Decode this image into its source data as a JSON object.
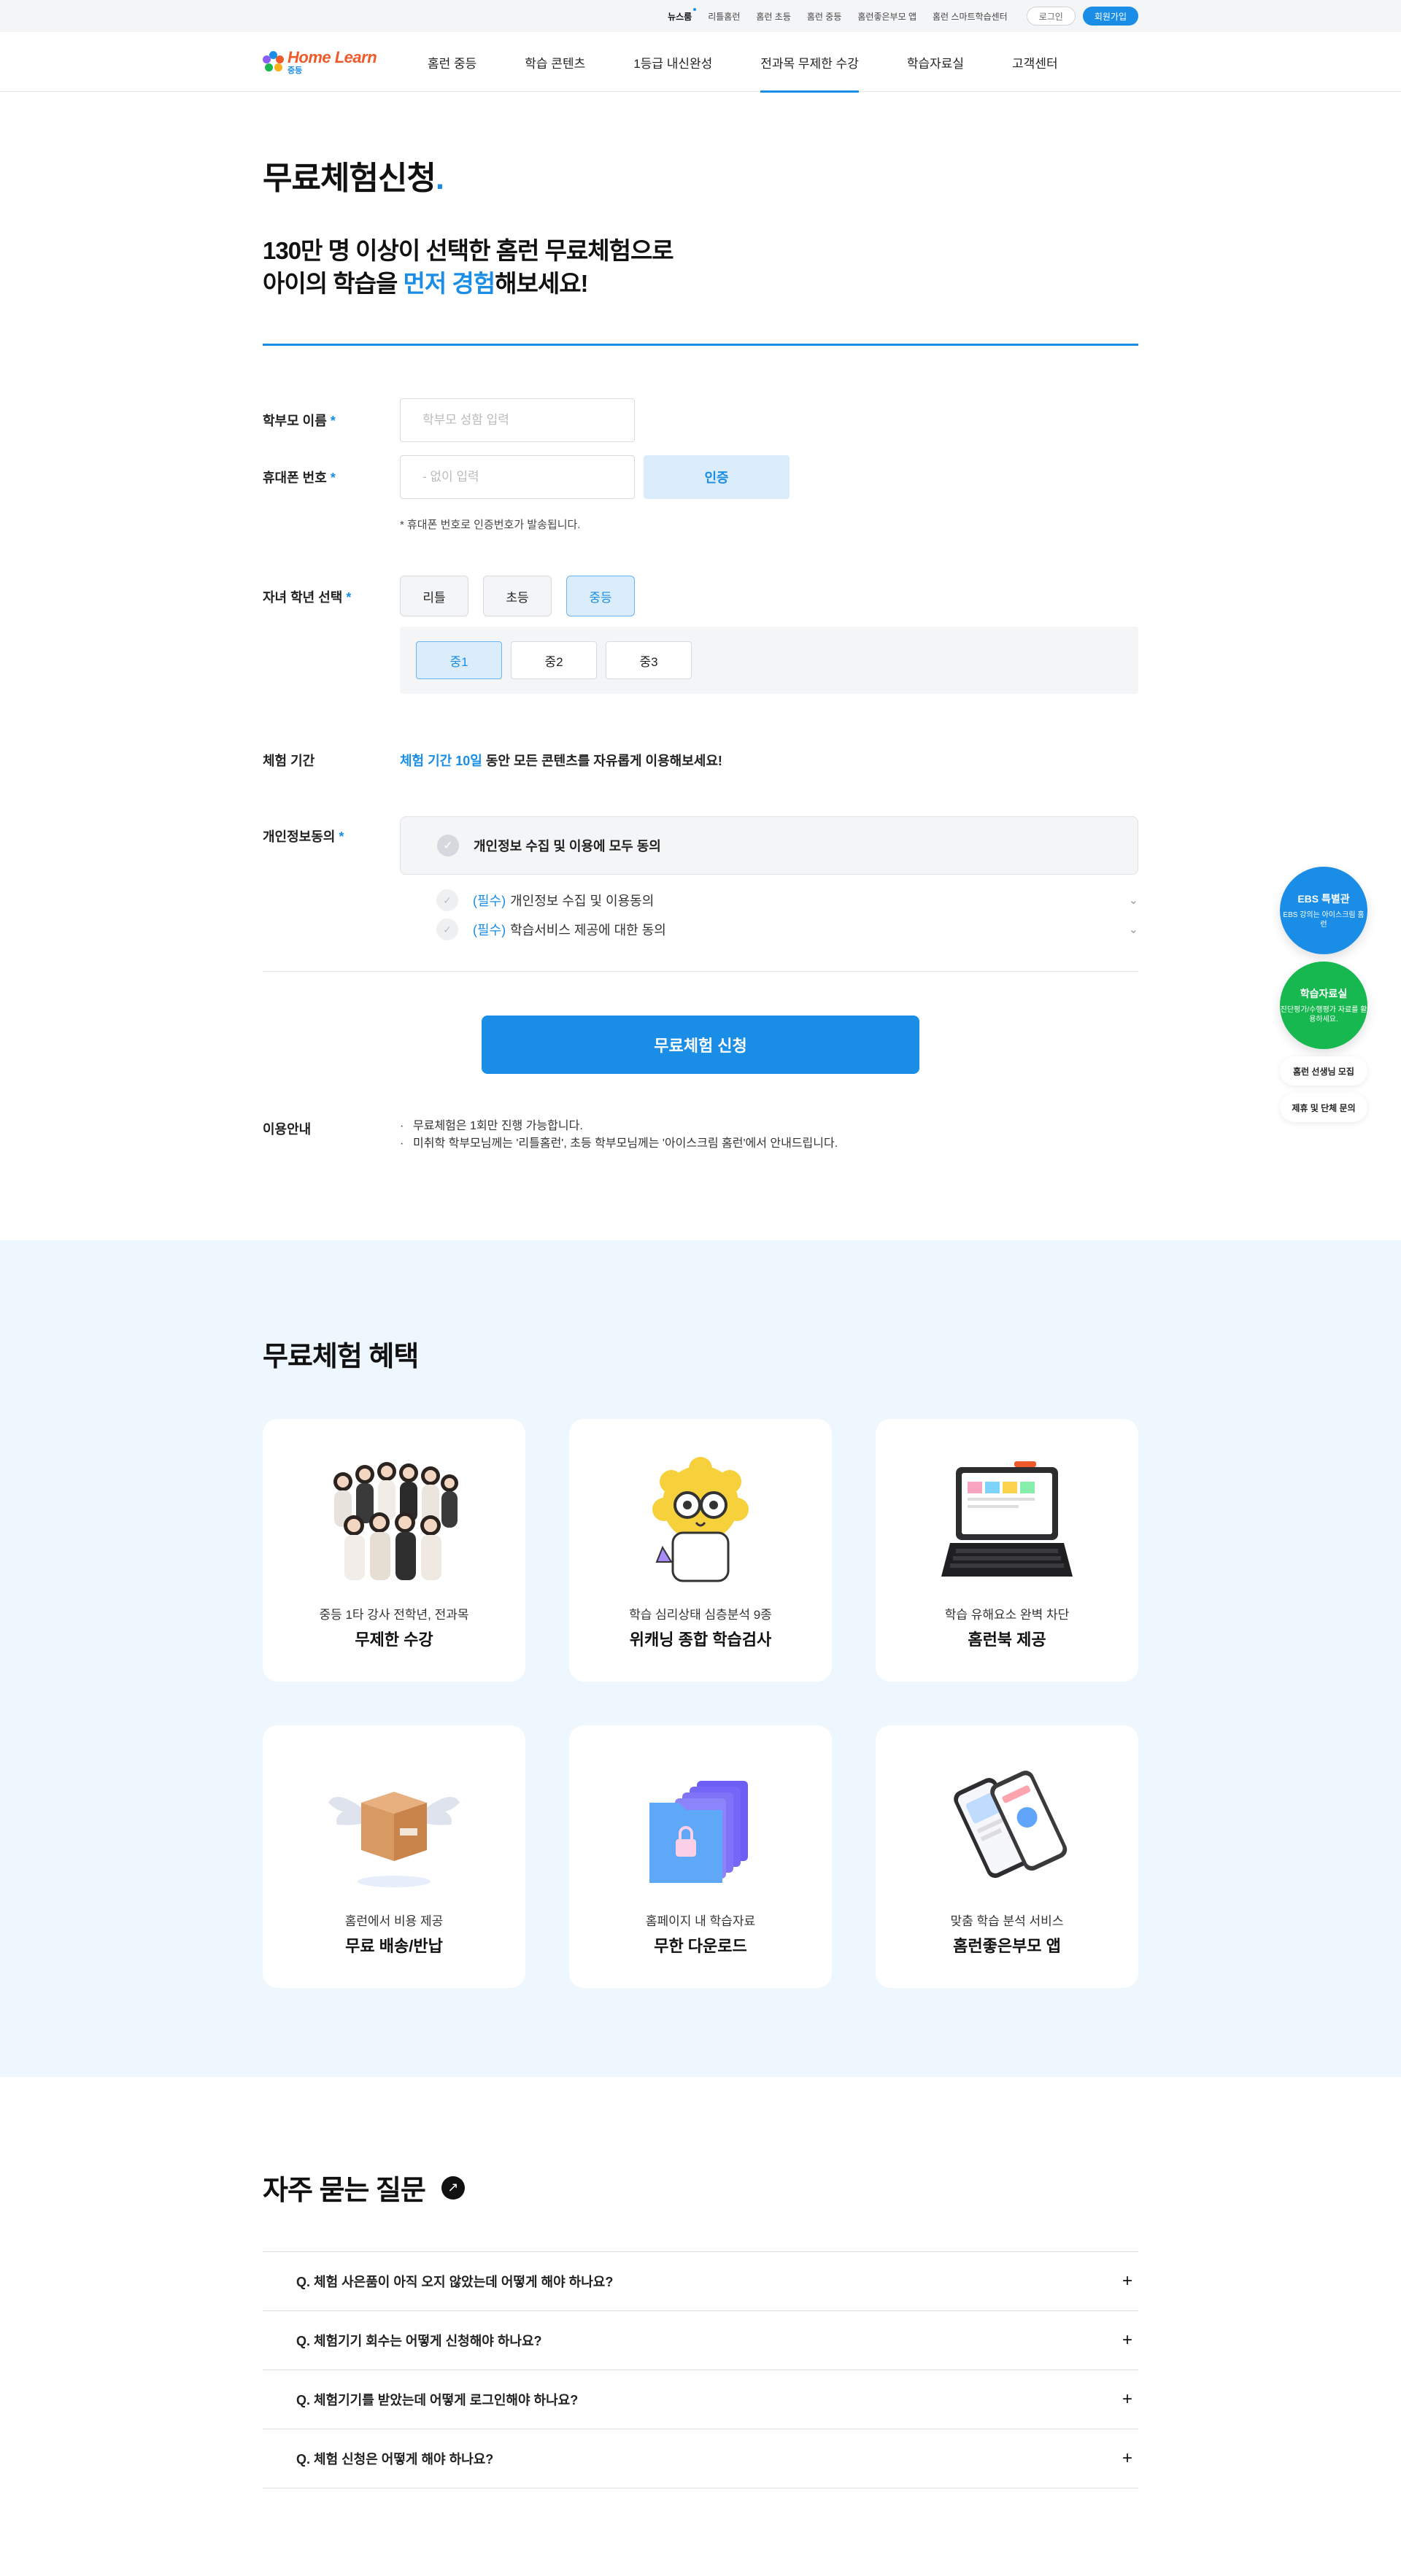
{
  "topbar": {
    "links": [
      "뉴스룸",
      "리틀홈런",
      "홈런 초등",
      "홈런 중등",
      "홈런좋은부모 앱",
      "홈런 스마트학습센터"
    ],
    "login": "로그인",
    "join": "회원가입"
  },
  "header": {
    "logo_brand": "Home Learn",
    "logo_sub": "중등",
    "nav": [
      "홈런 중등",
      "학습 콘텐츠",
      "1등급 내신완성",
      "전과목 무제한 수강",
      "학습자료실",
      "고객센터"
    ],
    "active_nav": "전과목 무제한 수강"
  },
  "form": {
    "title": "무료체험신청",
    "title_dot": ".",
    "lead_line1": "130만 명 이상이 선택한 홈런 무료체험으로",
    "lead_line2_pre": "아이의 학습을 ",
    "lead_line2_hl": "먼저 경험",
    "lead_line2_post": "해보세요!",
    "parent_name_label": "학부모 이름",
    "parent_name_placeholder": "학부모 성함 입력",
    "phone_label": "휴대폰 번호",
    "phone_placeholder": "- 없이 입력",
    "auth_button": "인증",
    "phone_notice": "* 휴대폰 번호로 인증번호가 발송됩니다.",
    "required_mark": "*",
    "grade_label": "자녀 학년 선택",
    "grade_options": [
      "리틀",
      "초등",
      "중등"
    ],
    "grade_selected": "중등",
    "sub_grade_options": [
      "중1",
      "중2",
      "중3"
    ],
    "sub_grade_selected": "중1",
    "period_label": "체험 기간",
    "period_hl": "체험 기간 10일",
    "period_text": " 동안 모든 콘텐츠를 자유롭게 이용해보세요!",
    "agree_label": "개인정보동의",
    "agree_all": "개인정보 수집 및 이용에 모두 동의",
    "agree_items": [
      {
        "req": "(필수)",
        "text": "개인정보 수집 및 이용동의"
      },
      {
        "req": "(필수)",
        "text": "학습서비스 제공에 대한 동의"
      }
    ],
    "submit": "무료체험 신청",
    "guide_label": "이용안내",
    "guide_items": [
      "무료체험은 1회만 진행 가능합니다.",
      "미취학 학부모님께는 '리틀홈런', 초등 학부모님께는 '아이스크림 홈런'에서 안내드립니다."
    ]
  },
  "benefits": {
    "title": "무료체험 혜택",
    "cards": [
      {
        "icon": "teachers-group-image",
        "caption": "중등 1타 강사 전학년, 전과목",
        "title": "무제한 수강"
      },
      {
        "icon": "scientist-mascot-image",
        "caption": "학습 심리상태 심층분석 9종",
        "title": "위캐닝 종합 학습검사"
      },
      {
        "icon": "tablet-keyboard-image",
        "caption": "학습 유해요소 완벽 차단",
        "title": "홈런북 제공"
      },
      {
        "icon": "winged-box-image",
        "caption": "홈런에서 비용 제공",
        "title": "무료 배송/반납"
      },
      {
        "icon": "folder-stack-image",
        "caption": "홈페이지 내 학습자료",
        "title": "무한 다운로드"
      },
      {
        "icon": "smartphones-image",
        "caption": "맞춤 학습 분석 서비스",
        "title": "홈런좋은부모 앱"
      }
    ]
  },
  "faq": {
    "title": "자주 묻는 질문",
    "items": [
      "Q. 체험 사은품이 아직 오지 않았는데 어떻게 해야 하나요?",
      "Q. 체험기기 회수는 어떻게 신청해야 하나요?",
      "Q. 체험기기를 받았는데 어떻게 로그인해야 하나요?",
      "Q. 체험 신청은 어떻게 해야 하나요?"
    ]
  },
  "floating": {
    "ebs_title": "EBS 특별관",
    "ebs_sub": "EBS 강의는 아이스크림 홈런",
    "lib_title": "학습자료실",
    "lib_sub": "진단평가/수행평가 자료를 활용하세요.",
    "link1": "홈런 선생님 모집",
    "link2": "제휴 및 단체 문의"
  },
  "colors": {
    "accent": "#1a8ee6",
    "brand_orange": "#ef5a2a",
    "green": "#17b84f",
    "benefit_bg": "#eef6fe"
  }
}
